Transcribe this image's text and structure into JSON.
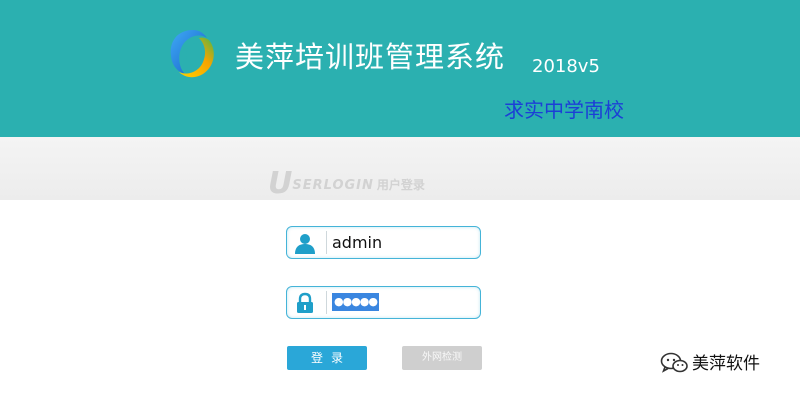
{
  "header": {
    "title": "美萍培训班管理系统",
    "version": "2018v5",
    "school": "求实中学南校"
  },
  "login_band": {
    "mark_letter": "U",
    "mark_text": "SERLOGIN",
    "mark_cn": "用户登录"
  },
  "form": {
    "username": {
      "icon": "user-icon",
      "value": "admin"
    },
    "password": {
      "icon": "lock-icon",
      "masked_value": "●●●●●"
    },
    "login_label": "登录",
    "network_check_label": "外网检测"
  },
  "watermark": {
    "icon": "wechat-icon",
    "text": "美萍软件"
  },
  "colors": {
    "header_bg": "#2bb0b0",
    "school_text": "#1c3fd6",
    "field_border": "#45b4d8",
    "login_button": "#2aa7d8",
    "disabled_button": "#cfcfcf"
  }
}
